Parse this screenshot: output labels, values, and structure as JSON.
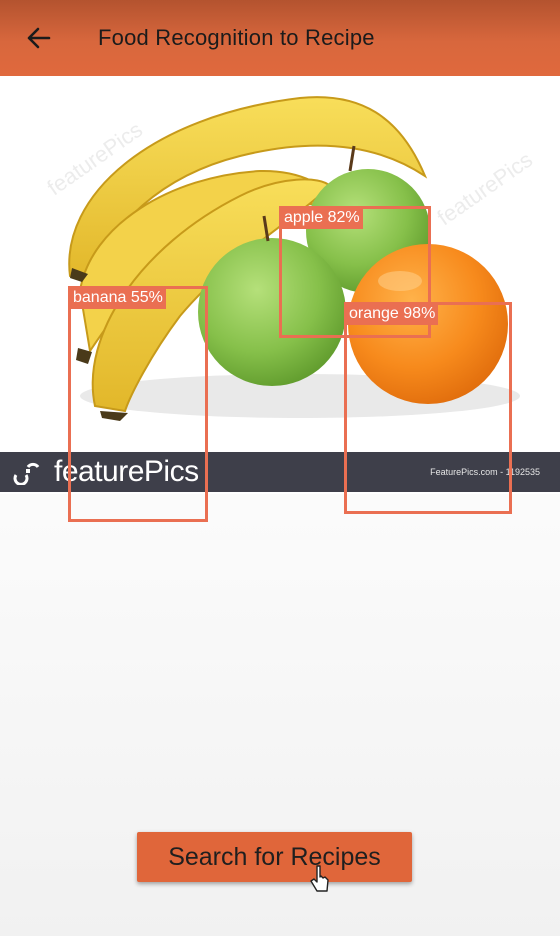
{
  "appbar": {
    "title": "Food Recognition to Recipe",
    "back_icon": "arrow-left-icon",
    "color": "#d8673d"
  },
  "image": {
    "watermark_text": "featurePics",
    "banner_logo": "featurePics",
    "banner_credit": "FeaturePics.com - 1192535"
  },
  "detections": [
    {
      "label": "banana 55%",
      "class": "banana",
      "confidence": 0.55
    },
    {
      "label": "apple 82%",
      "class": "apple",
      "confidence": 0.82
    },
    {
      "label": "orange 98%",
      "class": "orange",
      "confidence": 0.98
    }
  ],
  "detection_color": "#ea6f52",
  "actions": {
    "search_label": "Search for Recipes",
    "button_color": "#e0663a"
  }
}
